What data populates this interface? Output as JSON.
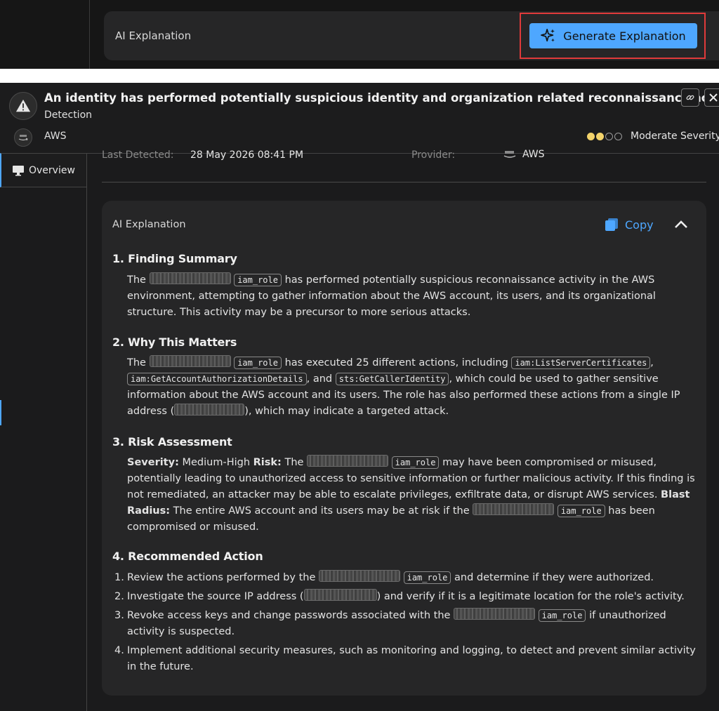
{
  "top": {
    "ai_label": "AI Explanation",
    "generate_label": "Generate Explanation"
  },
  "header": {
    "title": "An identity has performed potentially suspicious identity and organization related reconnaissance activity",
    "subtitle": "Detection",
    "provider": "AWS",
    "severity_text": "Moderate Severity",
    "severity_level": 2,
    "severity_max": 4
  },
  "sidebar": {
    "overview_label": "Overview"
  },
  "meta": {
    "last_detected_label": "Last Detected:",
    "last_detected_value": "28 May 2026 08:41 PM",
    "provider_label": "Provider:",
    "provider_value": "AWS"
  },
  "card": {
    "title": "AI Explanation",
    "copy_label": "Copy",
    "s1": {
      "heading": "1. Finding Summary",
      "the": "The",
      "code": "iam_role",
      "text": "has performed potentially suspicious reconnaissance activity in the AWS environment, attempting to gather information about the AWS account, its users, and its organizational structure. This activity may be a precursor to more serious attacks."
    },
    "s2": {
      "heading": "2. Why This Matters",
      "the": "The",
      "code_role": "iam_role",
      "text_a": "has executed 25 different actions, including",
      "code_a": "iam:ListServerCertificates",
      "comma": ",",
      "code_b": "iam:GetAccountAuthorizationDetails",
      "and": ", and",
      "code_c": "sts:GetCallerIdentity",
      "text_b": ", which could be used to gather sensitive information about the AWS account and its users. The role has also performed these actions from a single IP address (",
      "text_c": "), which may indicate a targeted attack."
    },
    "s3": {
      "heading": "3. Risk Assessment",
      "sev_label": "Severity:",
      "sev_val": "Medium-High",
      "risk_label": "Risk:",
      "the": "The",
      "code": "iam_role",
      "risk_text": "may have been compromised or misused, potentially leading to unauthorized access to sensitive information or further malicious activity. If this finding is not remediated, an attacker may be able to escalate privileges, exfiltrate data, or disrupt AWS services.",
      "blast_label": "Blast Radius:",
      "blast_text": "The entire AWS account and its users may be at risk if the",
      "code2": "iam_role",
      "blast_end": "has been compromised or misused."
    },
    "s4": {
      "heading": "4. Recommended Action",
      "i1_num": "1.",
      "i1_a": "Review the actions performed by the",
      "i1_code": "iam_role",
      "i1_b": "and determine if they were authorized.",
      "i2_num": "2.",
      "i2_a": "Investigate the source IP address (",
      "i2_b": ") and verify if it is a legitimate location for the role's activity.",
      "i3_num": "3.",
      "i3_a": "Revoke access keys and change passwords associated with the",
      "i3_code": "iam_role",
      "i3_b": "if unauthorized activity is suspected.",
      "i4_num": "4.",
      "i4_a": "Implement additional security measures, such as monitoring and logging, to detect and prevent similar activity in the future."
    }
  },
  "icons": {
    "sparkle": "sparkle-icon",
    "warning": "warning-icon",
    "copy": "copy-icon",
    "collapse": "chevron-up-icon",
    "monitor": "monitor-icon",
    "link": "link-icon",
    "close": "close-icon"
  },
  "colors": {
    "accent": "#4ea7ff",
    "highlight": "#e03a3a",
    "severity": "#f3d36b"
  }
}
